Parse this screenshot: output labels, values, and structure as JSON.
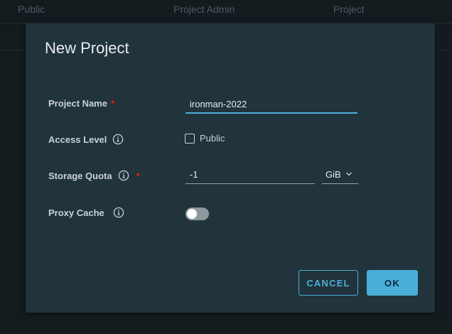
{
  "background": {
    "columns": [
      "Public",
      "Project Admin",
      "Project"
    ]
  },
  "dialog": {
    "title": "New Project",
    "project_name": {
      "label": "Project Name",
      "required_mark": "*",
      "value": "ironman-2022"
    },
    "access_level": {
      "label": "Access Level",
      "checkbox_label": "Public",
      "checked": false
    },
    "storage_quota": {
      "label": "Storage Quota",
      "required_mark": "*",
      "value": "-1",
      "unit": "GiB"
    },
    "proxy_cache": {
      "label": "Proxy Cache",
      "enabled": false
    },
    "buttons": {
      "cancel": "CANCEL",
      "ok": "OK"
    }
  },
  "colors": {
    "accent": "#49afd9",
    "required": "#e12200",
    "modal_bg": "#21333b",
    "page_bg": "#141b1f"
  }
}
